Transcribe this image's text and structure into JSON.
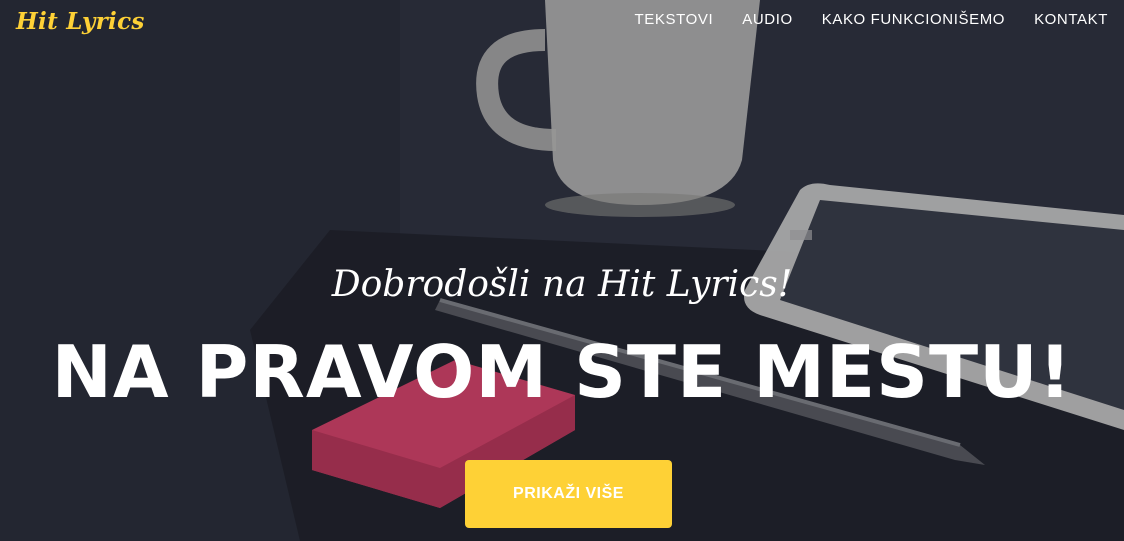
{
  "brand": {
    "name": "Hit Lyrics"
  },
  "nav": {
    "items": [
      {
        "label": "TEKSTOVI"
      },
      {
        "label": "AUDIO"
      },
      {
        "label": "KAKO FUNKCIONIŠEMO"
      },
      {
        "label": "KONTAKT"
      }
    ]
  },
  "hero": {
    "lead": "Dobrodošli na Hit Lyrics!",
    "heading": "NA PRAVOM STE MESTU!",
    "button_label": "PRIKAŽI VIŠE"
  },
  "colors": {
    "accent": "#fed136",
    "text": "#ffffff"
  }
}
